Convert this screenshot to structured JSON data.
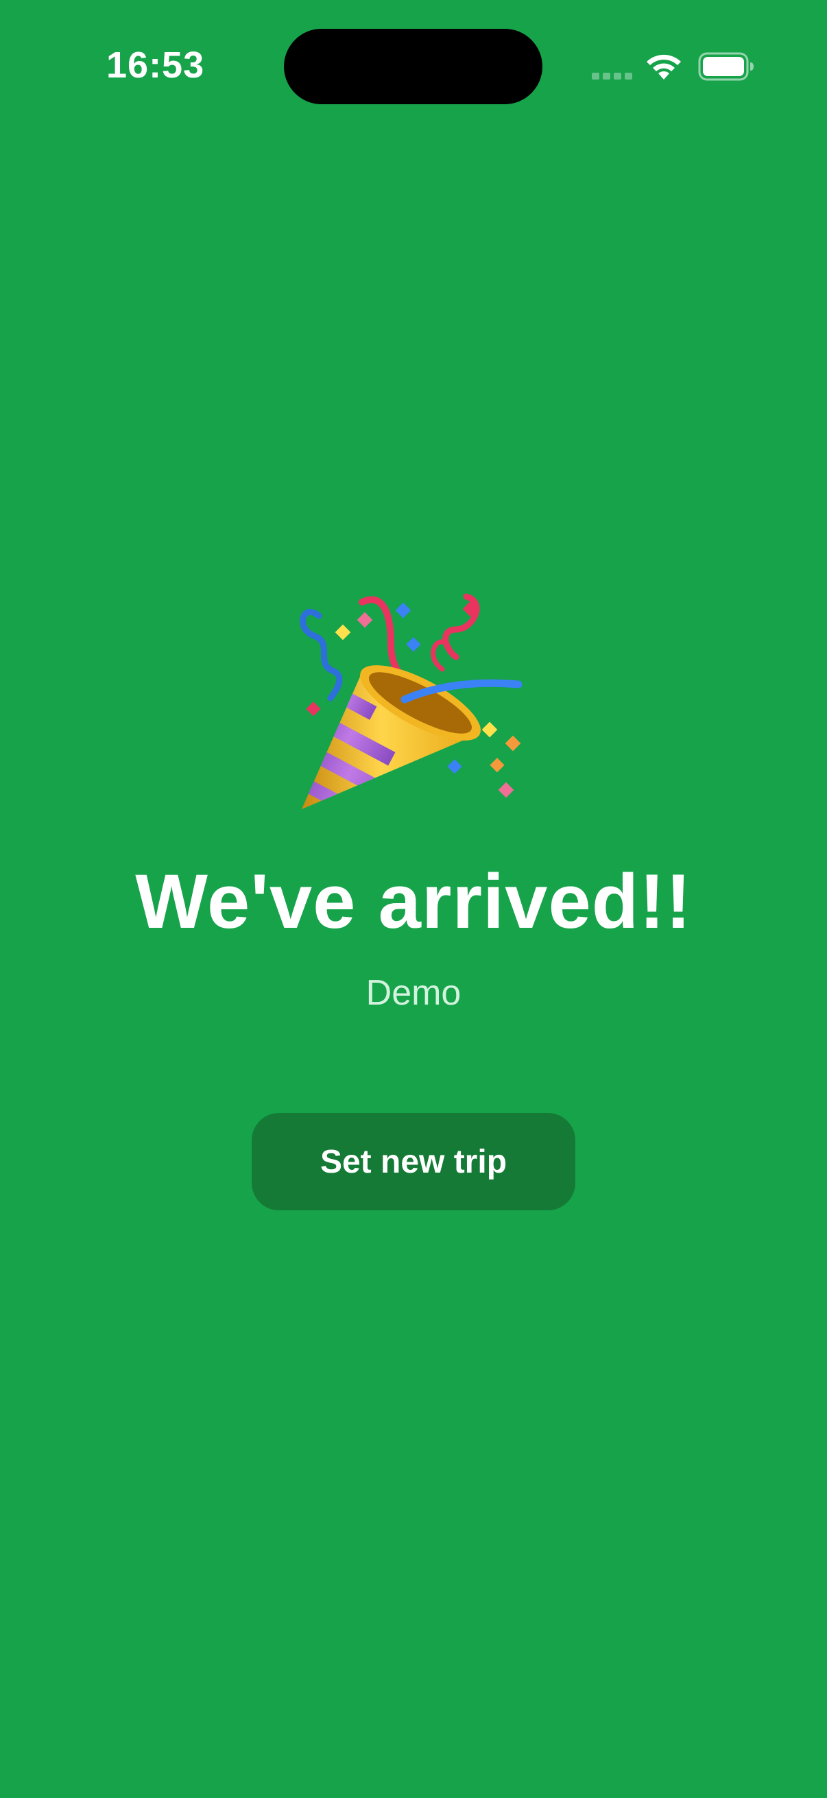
{
  "status_bar": {
    "time": "16:53",
    "icons": [
      "cellular-signal-icon",
      "wifi-icon",
      "battery-icon"
    ]
  },
  "main": {
    "icon": "party-popper-icon",
    "headline": "We've arrived!!",
    "subtitle": "Demo",
    "button_label": "Set new trip"
  },
  "colors": {
    "background": "#16a34a",
    "button": "#157a36",
    "text": "#ffffff",
    "subtitle_text": "#d3f3de"
  }
}
